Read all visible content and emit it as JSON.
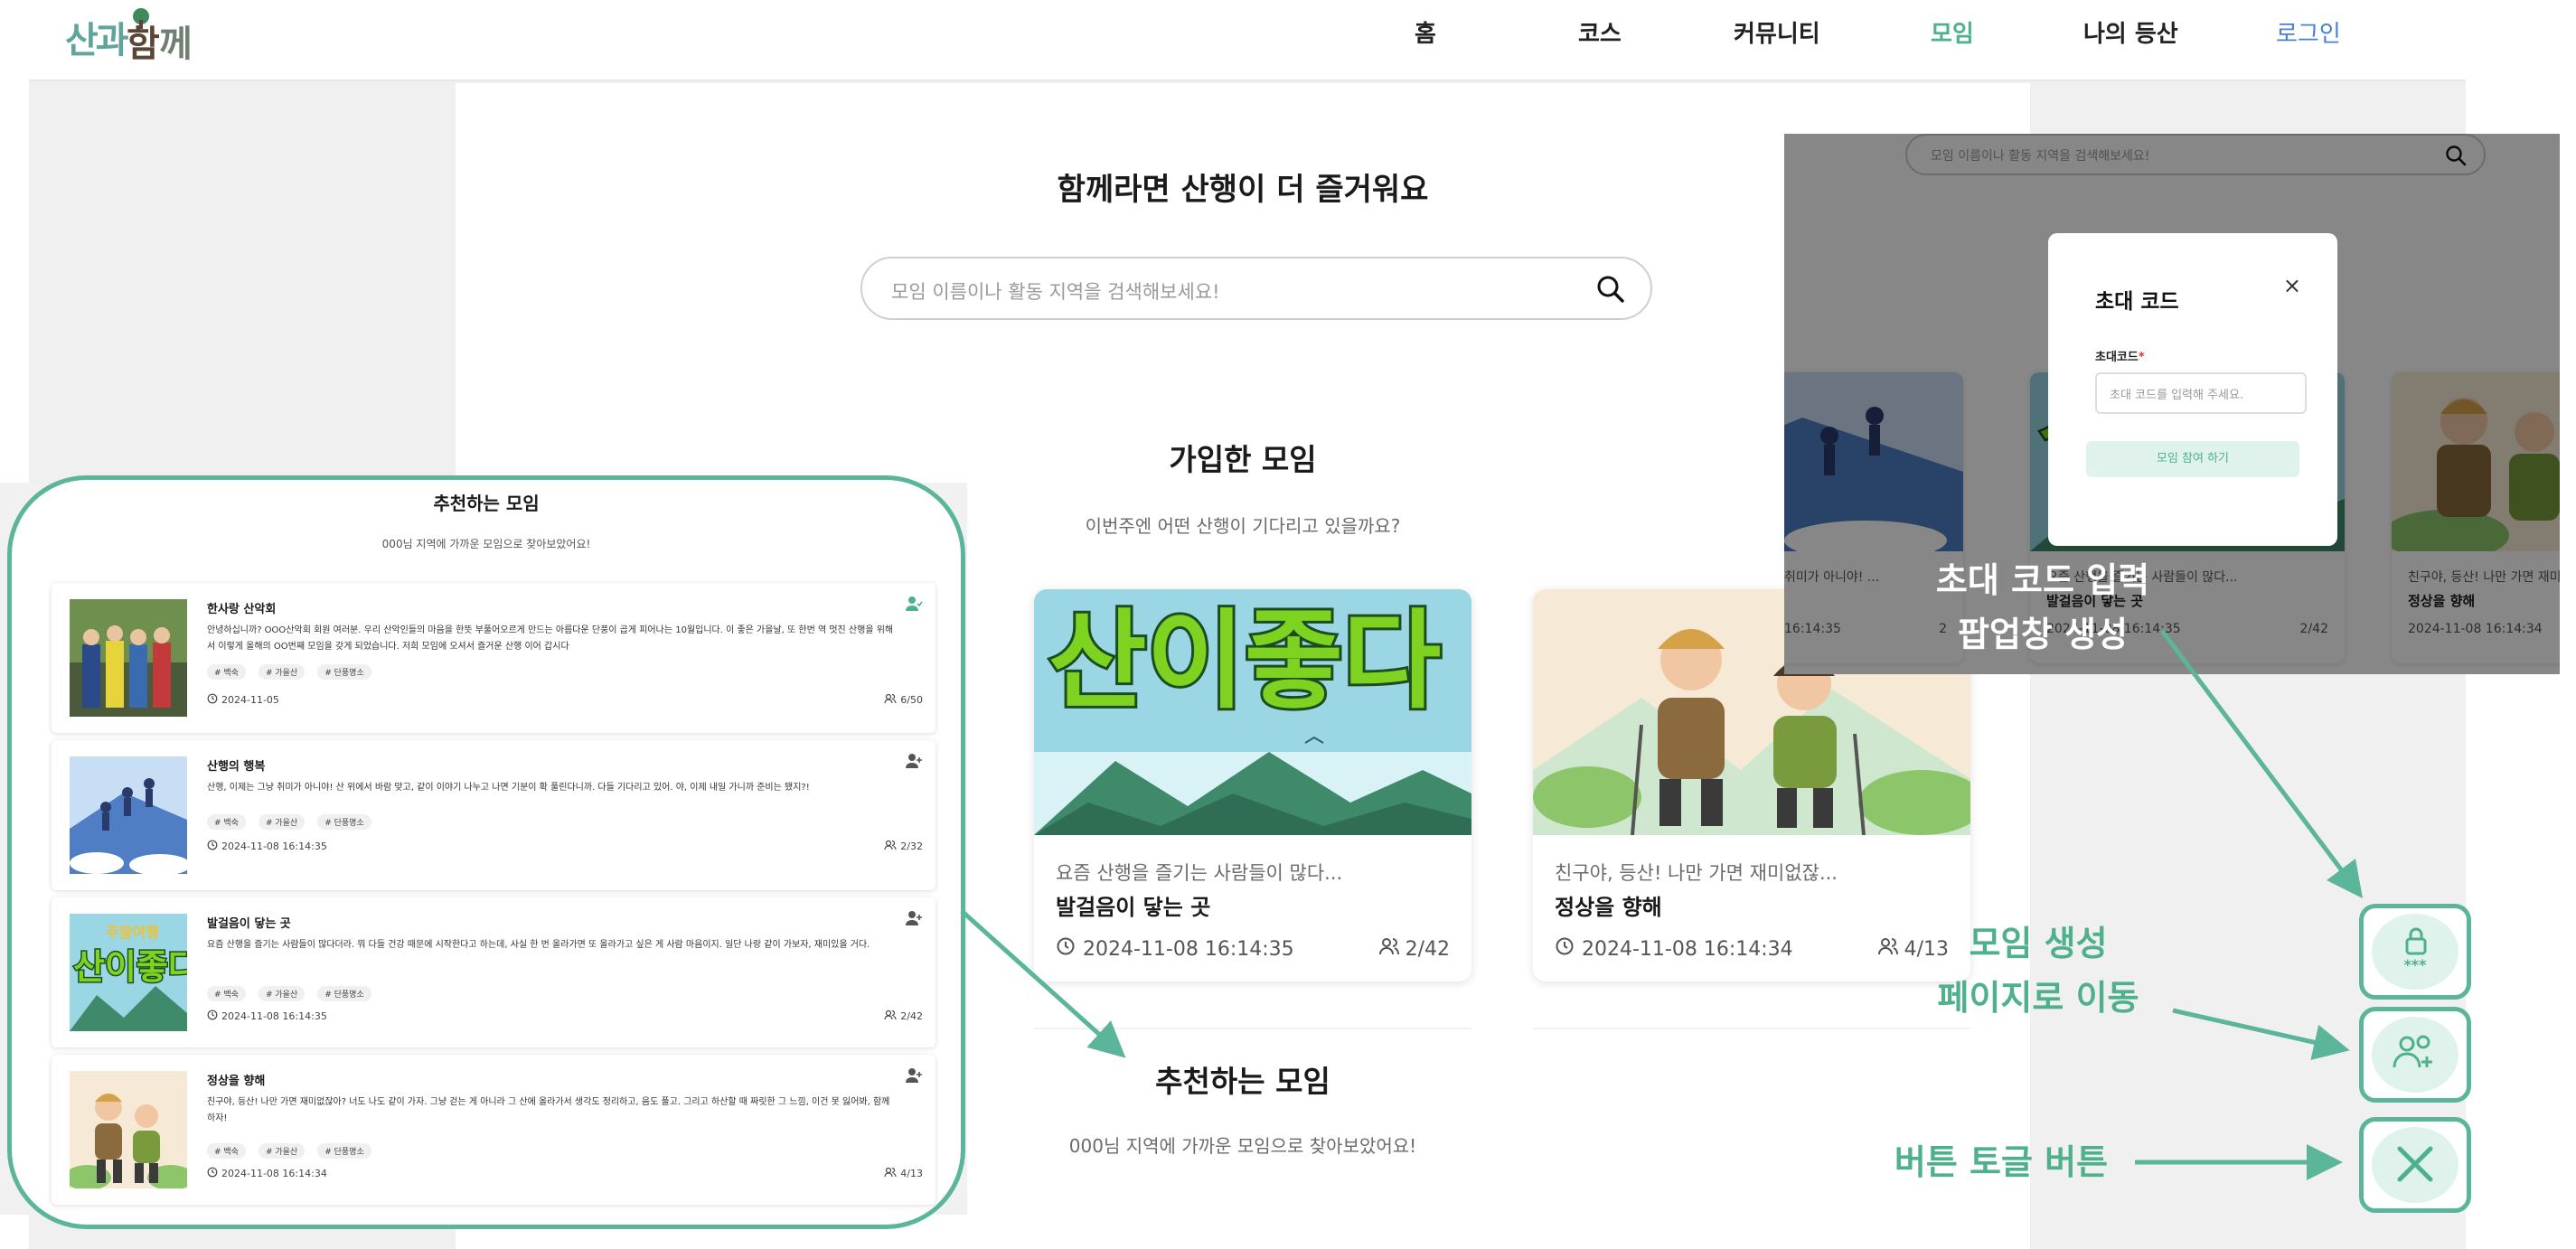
{
  "app": {
    "logo": "산과함께"
  },
  "nav": {
    "items": [
      "홈",
      "코스",
      "커뮤니티",
      "모임",
      "나의 등산"
    ],
    "login": "로그인"
  },
  "main": {
    "hero_title": "함께라면 산행이 더 즐거워요",
    "search_placeholder": "모임 이름이나 활동 지역을 검색해보세요!",
    "joined_title": "가입한 모임",
    "joined_sub": "이번주엔 어떤 산행이 기다리고 있을까요?",
    "cards": [
      {
        "desc": "요즘 산행을 즐기는 사람들이 많다...",
        "name": "발걸음이 닿는 곳",
        "date": "2024-11-08 16:14:35",
        "count": "2/42"
      },
      {
        "desc": "친구야, 등산! 나만 가면 재미없잖...",
        "name": "정상을 향해",
        "date": "2024-11-08 16:14:34",
        "count": "4/13"
      }
    ],
    "rec_title": "추천하는 모임",
    "rec_sub": "000님 지역에 가까운 모임으로 찾아보았어요!"
  },
  "left_panel": {
    "title": "추천하는 모임",
    "sub": "000님 지역에 가까운 모임으로 찾아보았어요!",
    "rows": [
      {
        "name": "한사랑 산악회",
        "desc": "안녕하십니까? OOO산악회 회원 여러분. 우리 산악인들의 마음을 한뜻 부풀어오르게 만드는 아름다운 단풍이 곱게 피어나는 10월입니다. 이 좋은 가을날, 또 한번 역 멋진 산행을 위해서 이렇게 올해의 OO번째 모임을 갖게 되었습니다. 저희 모임에 오셔서 즐거운 산행 이어 갑시다",
        "tags": [
          "# 백숙",
          "# 가을산",
          "# 단풍명소"
        ],
        "date": "2024-11-05",
        "count": "6/50"
      },
      {
        "name": "산행의 행복",
        "desc": "산행, 이제는 그냥 취미가 아니야! 산 위에서 바람 맞고, 같이 이야기 나누고 나면 기분이 확 풀린다니까. 다들 기다리고 있어. 야, 이제 내일 가니까 준비는 됐지?!",
        "tags": [
          "# 백숙",
          "# 가을산",
          "# 단풍명소"
        ],
        "date": "2024-11-08 16:14:35",
        "count": "2/32"
      },
      {
        "name": "발걸음이 닿는 곳",
        "desc": "요즘 산행을 즐기는 사람들이 많다더라. 뭐 다들 건강 때문에 시작한다고 하는데, 사실 한 번 올라가면 또 올라가고 싶은 게 사람 마음이지. 일단 나랑 같이 가보자, 재미있을 거다.",
        "tags": [
          "# 백숙",
          "# 가을산",
          "# 단풍명소"
        ],
        "date": "2024-11-08 16:14:35",
        "count": "2/42"
      },
      {
        "name": "정상을 향해",
        "desc": "친구야, 등산! 나만 가면 재미없잖아? 너도 나도 같이 가자. 그냥 걷는 게 아니라 그 산에 올라가서 생각도 정리하고, 음도 풀고. 그리고 하산할 때 짜릿한 그 느낌, 이건 못 잃어봐, 함께 하자!",
        "tags": [
          "# 백숙",
          "# 가을산",
          "# 단풍명소"
        ],
        "date": "2024-11-08 16:14:34",
        "count": "4/13"
      }
    ]
  },
  "popup": {
    "search_placeholder": "모임 이름이나 활동 지역을 검색해보세요!",
    "cards": [
      {
        "desc": "취미가 아니야! ...",
        "name": "",
        "date": "16:14:35",
        "count": "2"
      },
      {
        "desc": "요즘 산행을 즐기는 사람들이 많다...",
        "name": "발걸음이 닿는 곳",
        "date": "2024-11-08 16:14:35",
        "count": "2/42"
      },
      {
        "desc": "친구야, 등산! 나만 가면 재미없...",
        "name": "정상을 향해",
        "date": "2024-11-08 16:14:34",
        "count": ""
      }
    ],
    "modal": {
      "title": "초대 코드",
      "close": "×",
      "label": "초대코드",
      "required_mark": "*",
      "placeholder": "초대 코드를 입력해 주세요.",
      "submit": "모임 참여 하기"
    }
  },
  "annotations": {
    "invite_line1": "초대 코드 입력",
    "invite_line2": "팝업창 생성",
    "create_line1": "모임 생성",
    "create_line2": "페이지로 이동",
    "toggle": "버튼 토글 버튼"
  },
  "colors": {
    "accent": "#4fb08c",
    "annotation": "#5ab59a",
    "login": "#4a7fd6"
  },
  "icons": {
    "fab1": "lock-code-icon",
    "fab2": "group-add-icon",
    "fab3": "close-icon"
  }
}
